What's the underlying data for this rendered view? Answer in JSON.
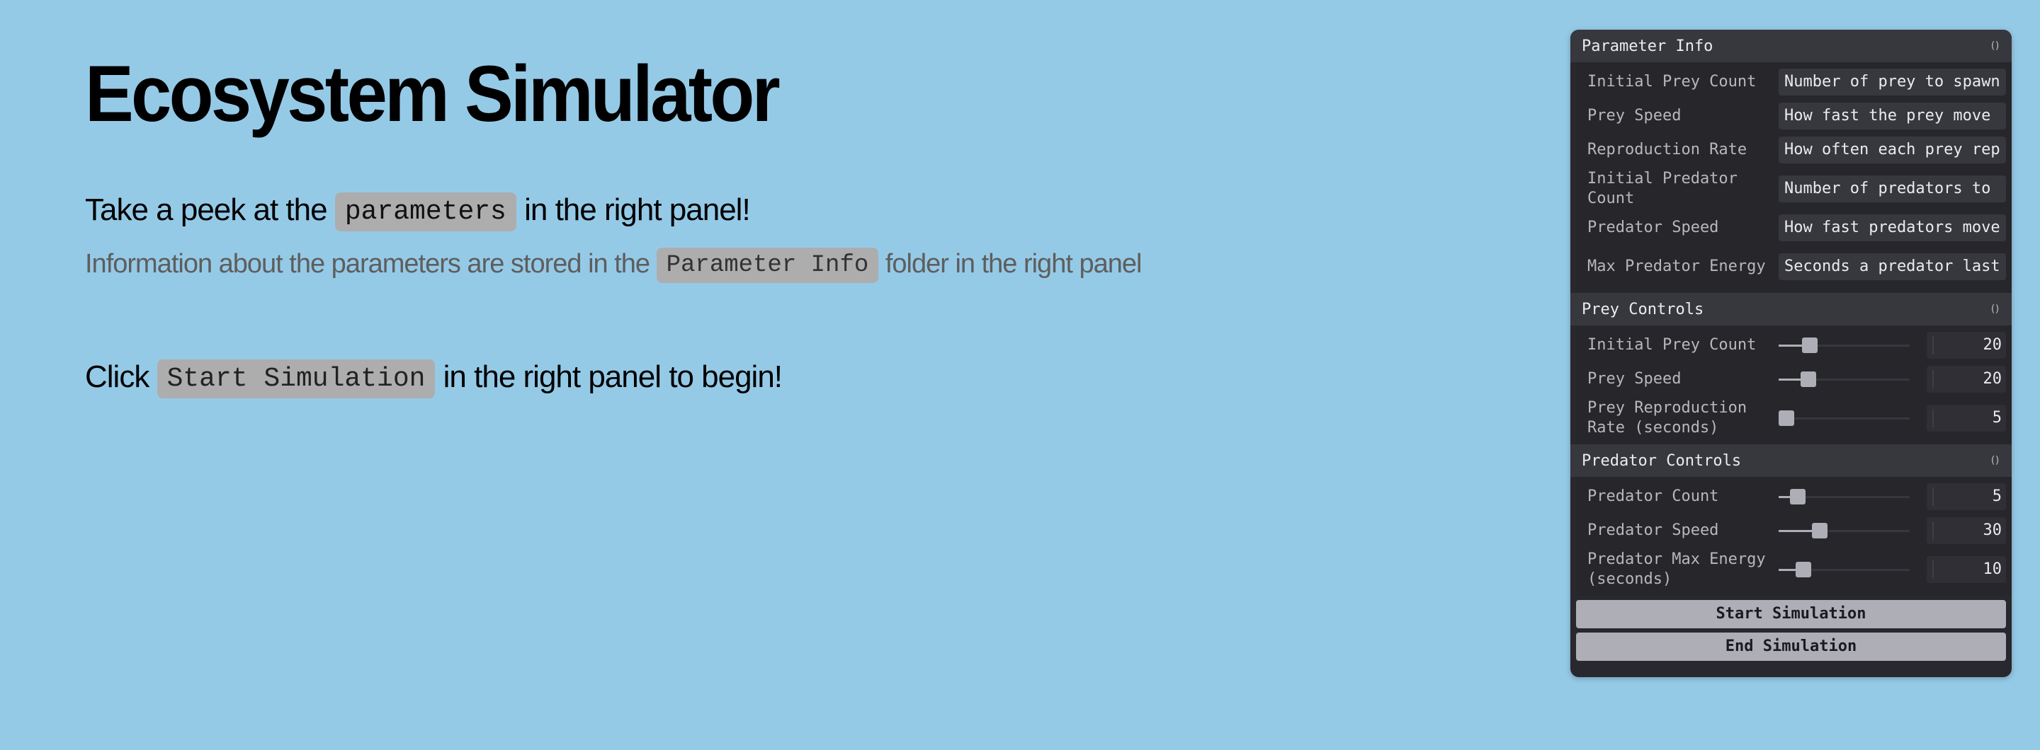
{
  "main": {
    "title": "Ecosystem Simulator",
    "line1": {
      "before": "Take a peek at the",
      "code": "parameters",
      "after": "in the right panel!"
    },
    "line2": {
      "before": "Information about the parameters are stored in the",
      "code": "Parameter Info",
      "after": "folder in the right panel"
    },
    "line3": {
      "before": "Click",
      "code": "Start Simulation",
      "after": "in the right panel to begin!"
    }
  },
  "panel": {
    "param_info": {
      "title": "Parameter Info",
      "rows": [
        {
          "label": "Initial Prey Count",
          "value": "Number of prey to spawn"
        },
        {
          "label": "Prey Speed",
          "value": "How fast the prey move"
        },
        {
          "label": "Reproduction Rate",
          "value": "How often each prey rep"
        },
        {
          "label": "Initial Predator Count",
          "value": "Number of predators to"
        },
        {
          "label": "Predator Speed",
          "value": "How fast predators move"
        },
        {
          "label": "Max Predator Energy",
          "value": "Seconds a predator last"
        }
      ]
    },
    "prey_controls": {
      "title": "Prey Controls",
      "rows": [
        {
          "label": "Initial Prey Count",
          "value": "20",
          "fill": 0.2
        },
        {
          "label": "Prey Speed",
          "value": "20",
          "fill": 0.19
        },
        {
          "label": "Prey Reproduction Rate (seconds)",
          "value": "5",
          "fill": 0.0
        }
      ]
    },
    "predator_controls": {
      "title": "Predator Controls",
      "rows": [
        {
          "label": "Predator Count",
          "value": "5",
          "fill": 0.1
        },
        {
          "label": "Predator Speed",
          "value": "30",
          "fill": 0.29
        },
        {
          "label": "Predator Max Energy (seconds)",
          "value": "10",
          "fill": 0.15
        }
      ]
    },
    "start_label": "Start Simulation",
    "end_label": "End Simulation"
  }
}
